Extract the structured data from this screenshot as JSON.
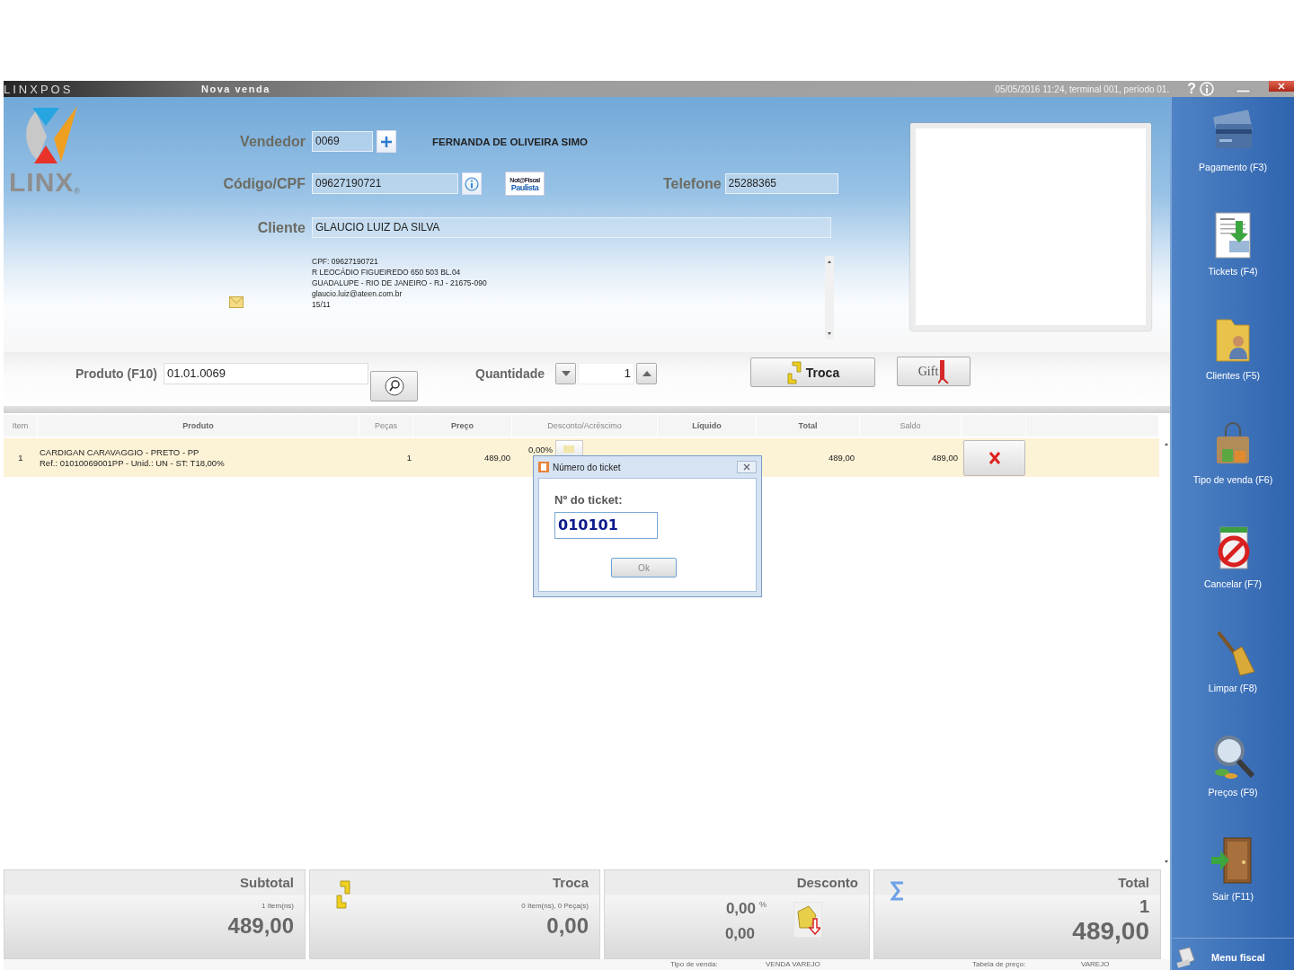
{
  "title_bar": {
    "app": "LINXPOS",
    "screen": "Nova venda",
    "session": "05/05/2016 11:24, terminal 001, período 01.",
    "help": "?"
  },
  "logo": {
    "wordmark": "LINX",
    "mark": "®"
  },
  "seller": {
    "label": "Vendedor",
    "code": "0069",
    "name": "FERNANDA DE OLIVEIRA SIMO"
  },
  "customer_code": {
    "label": "Código/CPF",
    "value": "09627190721"
  },
  "nfp_badge": {
    "top": "Not@Fiscal",
    "bottom": "Paulista"
  },
  "phone": {
    "label": "Telefone",
    "value": "25288365"
  },
  "client": {
    "label": "Cliente",
    "value": "GLAUCIO LUIZ DA SILVA"
  },
  "client_details": [
    "CPF: 09627190721",
    "R LEOCÁDIO FIGUEIREDO 650 503 BL.04",
    "GUADALUPE - RIO DE JANEIRO - RJ - 21675-090",
    "glaucio.luiz@ateen.com.br",
    "15/11"
  ],
  "product": {
    "label": "Produto (F10)",
    "value": "01.01.0069"
  },
  "quantity": {
    "label": "Quantidade",
    "value": "1"
  },
  "exchange_button": {
    "label": "Troca"
  },
  "gift_button": {
    "label": "Gift"
  },
  "table": {
    "columns": [
      "Item",
      "Produto",
      "Peças",
      "Preço",
      "Desconto/Acréscimo",
      "Líquido",
      "Total",
      "Saldo"
    ],
    "rows": [
      {
        "item": "1",
        "product": "CARDIGAN CARAVAGGIO - PRETO - PP",
        "reference": "Ref.: 01010069001PP - Unid.: UN - ST: T18,00%",
        "pieces": "1",
        "price": "489,00",
        "discount": "0,00%",
        "total": "489,00",
        "balance": "489,00",
        "selected": true
      }
    ]
  },
  "dialog": {
    "title": "Número do ticket",
    "label": "Nº do ticket:",
    "value": "010101",
    "ok": "Ok"
  },
  "totals": [
    {
      "kind": "subtotal",
      "title": "Subtotal",
      "detail": "1 Item(ns)",
      "value": "489,00"
    },
    {
      "kind": "exchange",
      "title": "Troca",
      "detail": "0 Item(ns), 0 Peça(s)",
      "value": "0,00"
    },
    {
      "kind": "discount",
      "title": "Desconto",
      "percent": "0,00",
      "percent_sign": "%",
      "value": "0,00"
    },
    {
      "kind": "total",
      "title": "Total",
      "count": "1",
      "value": "489,00"
    }
  ],
  "status_bar": [
    {
      "label": "Tipo de venda:",
      "value": "VENDA VAREJO"
    },
    {
      "label": "Tabela de preço:",
      "value": "VAREJO"
    }
  ],
  "sidebar": {
    "items": [
      {
        "kind": "payment",
        "label": "Pagamento (F3)"
      },
      {
        "kind": "tickets",
        "label": "Tickets (F4)"
      },
      {
        "kind": "clients",
        "label": "Clientes (F5)"
      },
      {
        "kind": "sale_type",
        "label": "Tipo de venda (F6)"
      },
      {
        "kind": "cancel",
        "label": "Cancelar (F7)"
      },
      {
        "kind": "clear",
        "label": "Limpar (F8)"
      },
      {
        "kind": "prices",
        "label": "Preços (F9)"
      },
      {
        "kind": "exit",
        "label": "Sair (F11)"
      }
    ],
    "menu_fiscal": "Menu fiscal"
  }
}
